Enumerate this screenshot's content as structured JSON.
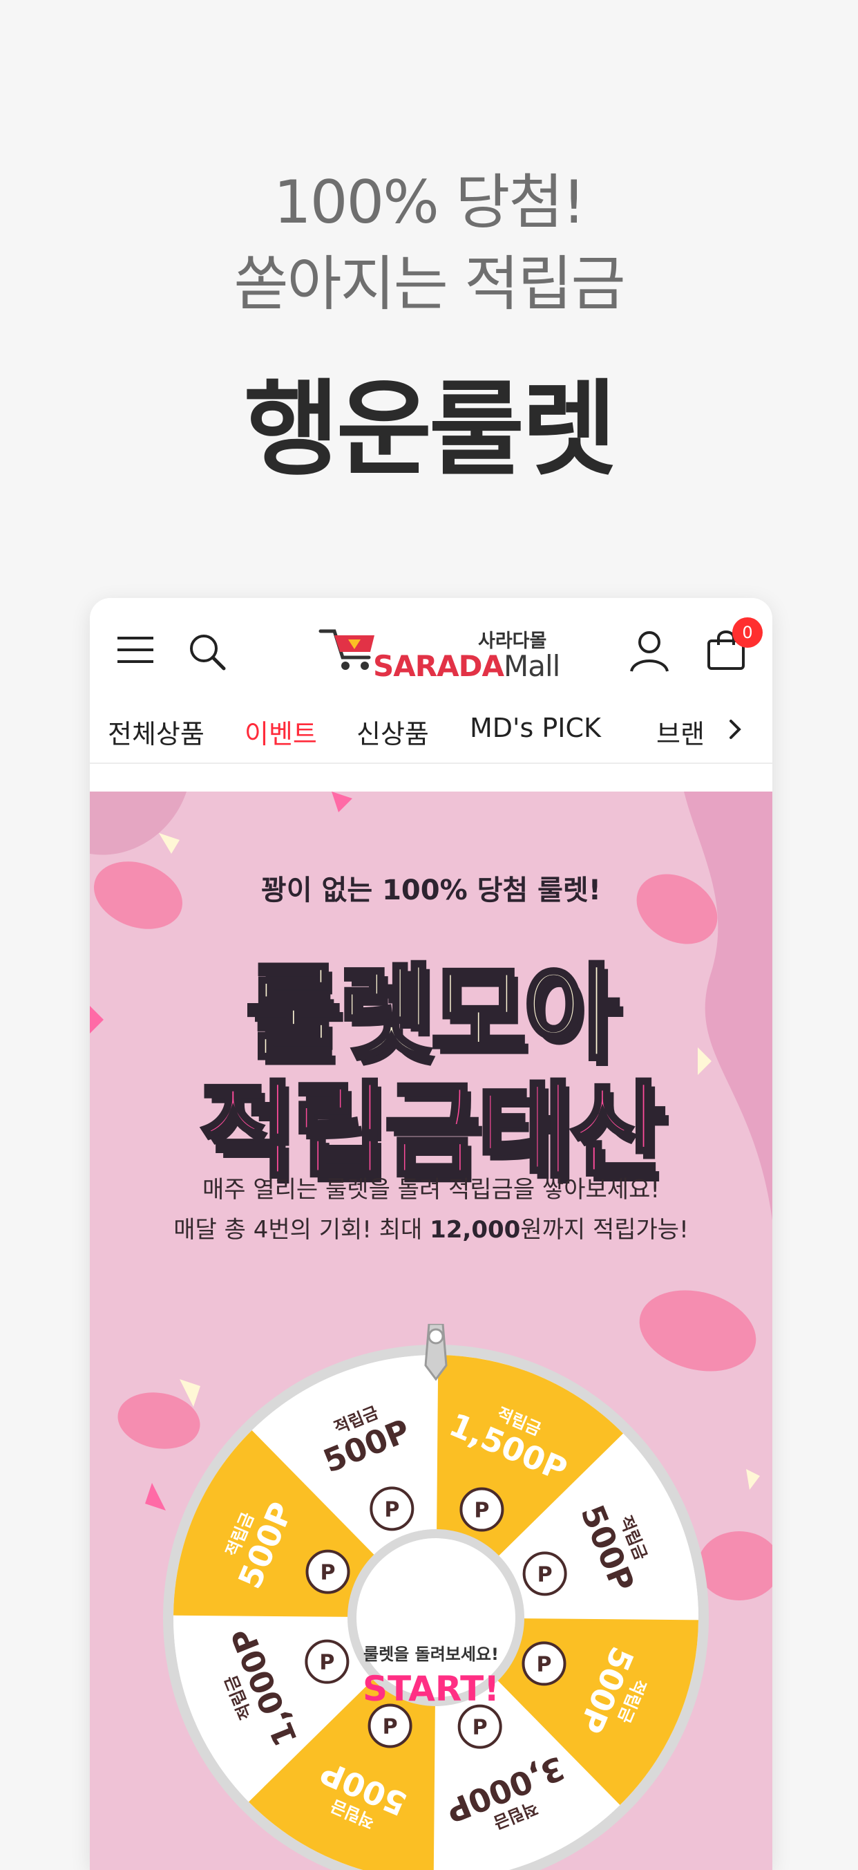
{
  "promo": {
    "line1": "100% 당첨!",
    "line2": "쏟아지는 적립금",
    "title": "행운룰렛"
  },
  "header": {
    "logo_kr": "사라다몰",
    "logo_brand": "SARADA",
    "logo_mall": "Mall",
    "cart_count": "0"
  },
  "nav": {
    "items": [
      "전체상품",
      "이벤트",
      "신상품",
      "MD's PICK",
      "브랜"
    ],
    "active_index": 1
  },
  "banner": {
    "tag": "꽝이 없는 100% 당첨 룰렛!",
    "title1": "룰렛모아",
    "title2": "적립금태산",
    "desc1": "매주 열리는 룰렛을 돌려 적립금을 쌓아보세요!",
    "desc2_prefix": "매달 총 4번의 기회! 최대 ",
    "desc2_highlight": "12,000",
    "desc2_suffix": "원까지 적립가능!"
  },
  "wheel": {
    "center_sub": "룰렛을 돌려보세요!",
    "center_cta": "START!",
    "segments": [
      {
        "small": "적립금",
        "big": "500P"
      },
      {
        "small": "적립금",
        "big": "1,500P"
      },
      {
        "small": "적립금",
        "big": "500P"
      },
      {
        "small": "적립금",
        "big": "500P"
      },
      {
        "small": "적립금",
        "big": "3,000P"
      },
      {
        "small": "적립금",
        "big": "500P"
      },
      {
        "small": "적립금",
        "big": "1,000P"
      },
      {
        "small": "적립금",
        "big": "500P"
      }
    ],
    "colors": {
      "yellow": "#fbbf24",
      "white": "#ffffff",
      "rim": "#d9d9d9"
    }
  },
  "colors": {
    "accent_red": "#ff2b3b",
    "banner_bg": "#efc2d6",
    "pink": "#ff4c9b"
  }
}
